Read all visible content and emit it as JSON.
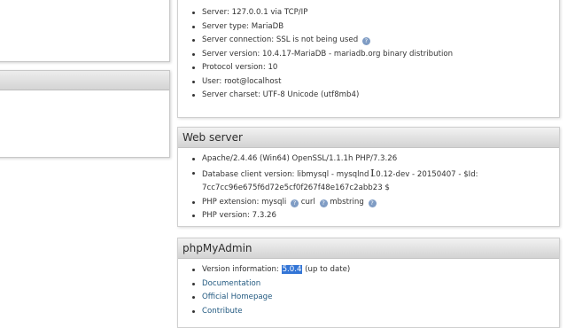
{
  "db_server": {
    "items": [
      "Server: 127.0.0.1 via TCP/IP",
      "Server type: MariaDB",
      "Server connection: SSL is not being used",
      "Server version: 10.4.17-MariaDB - mariadb.org binary distribution",
      "Protocol version: 10",
      "User: root@localhost",
      "Server charset: UTF-8 Unicode (utf8mb4)"
    ]
  },
  "web_server": {
    "title": "Web server",
    "apache": "Apache/2.4.46 (Win64) OpenSSL/1.1.1h PHP/7.3.26",
    "db_client_prefix": "Database client version: libmysql - mysqlnd ",
    "db_client_suffix": ".0.12-dev - 20150407 - $Id:",
    "db_client_line2": "7cc7cc96e675f6d72e5cf0f267f48e167c2abb23 $",
    "php_ext_label": "PHP extension: ",
    "php_ext_1": "mysqli",
    "php_ext_2": "curl",
    "php_ext_3": "mbstring",
    "php_version": "PHP version: 7.3.26"
  },
  "phpmyadmin": {
    "title": "phpMyAdmin",
    "version_label": "Version information: ",
    "version_value": "5.0.4",
    "version_status": " (up to date)",
    "links": [
      "Documentation",
      "Official Homepage",
      "Contribute"
    ]
  },
  "icons": {
    "help": "?",
    "text_cursor": "I"
  }
}
